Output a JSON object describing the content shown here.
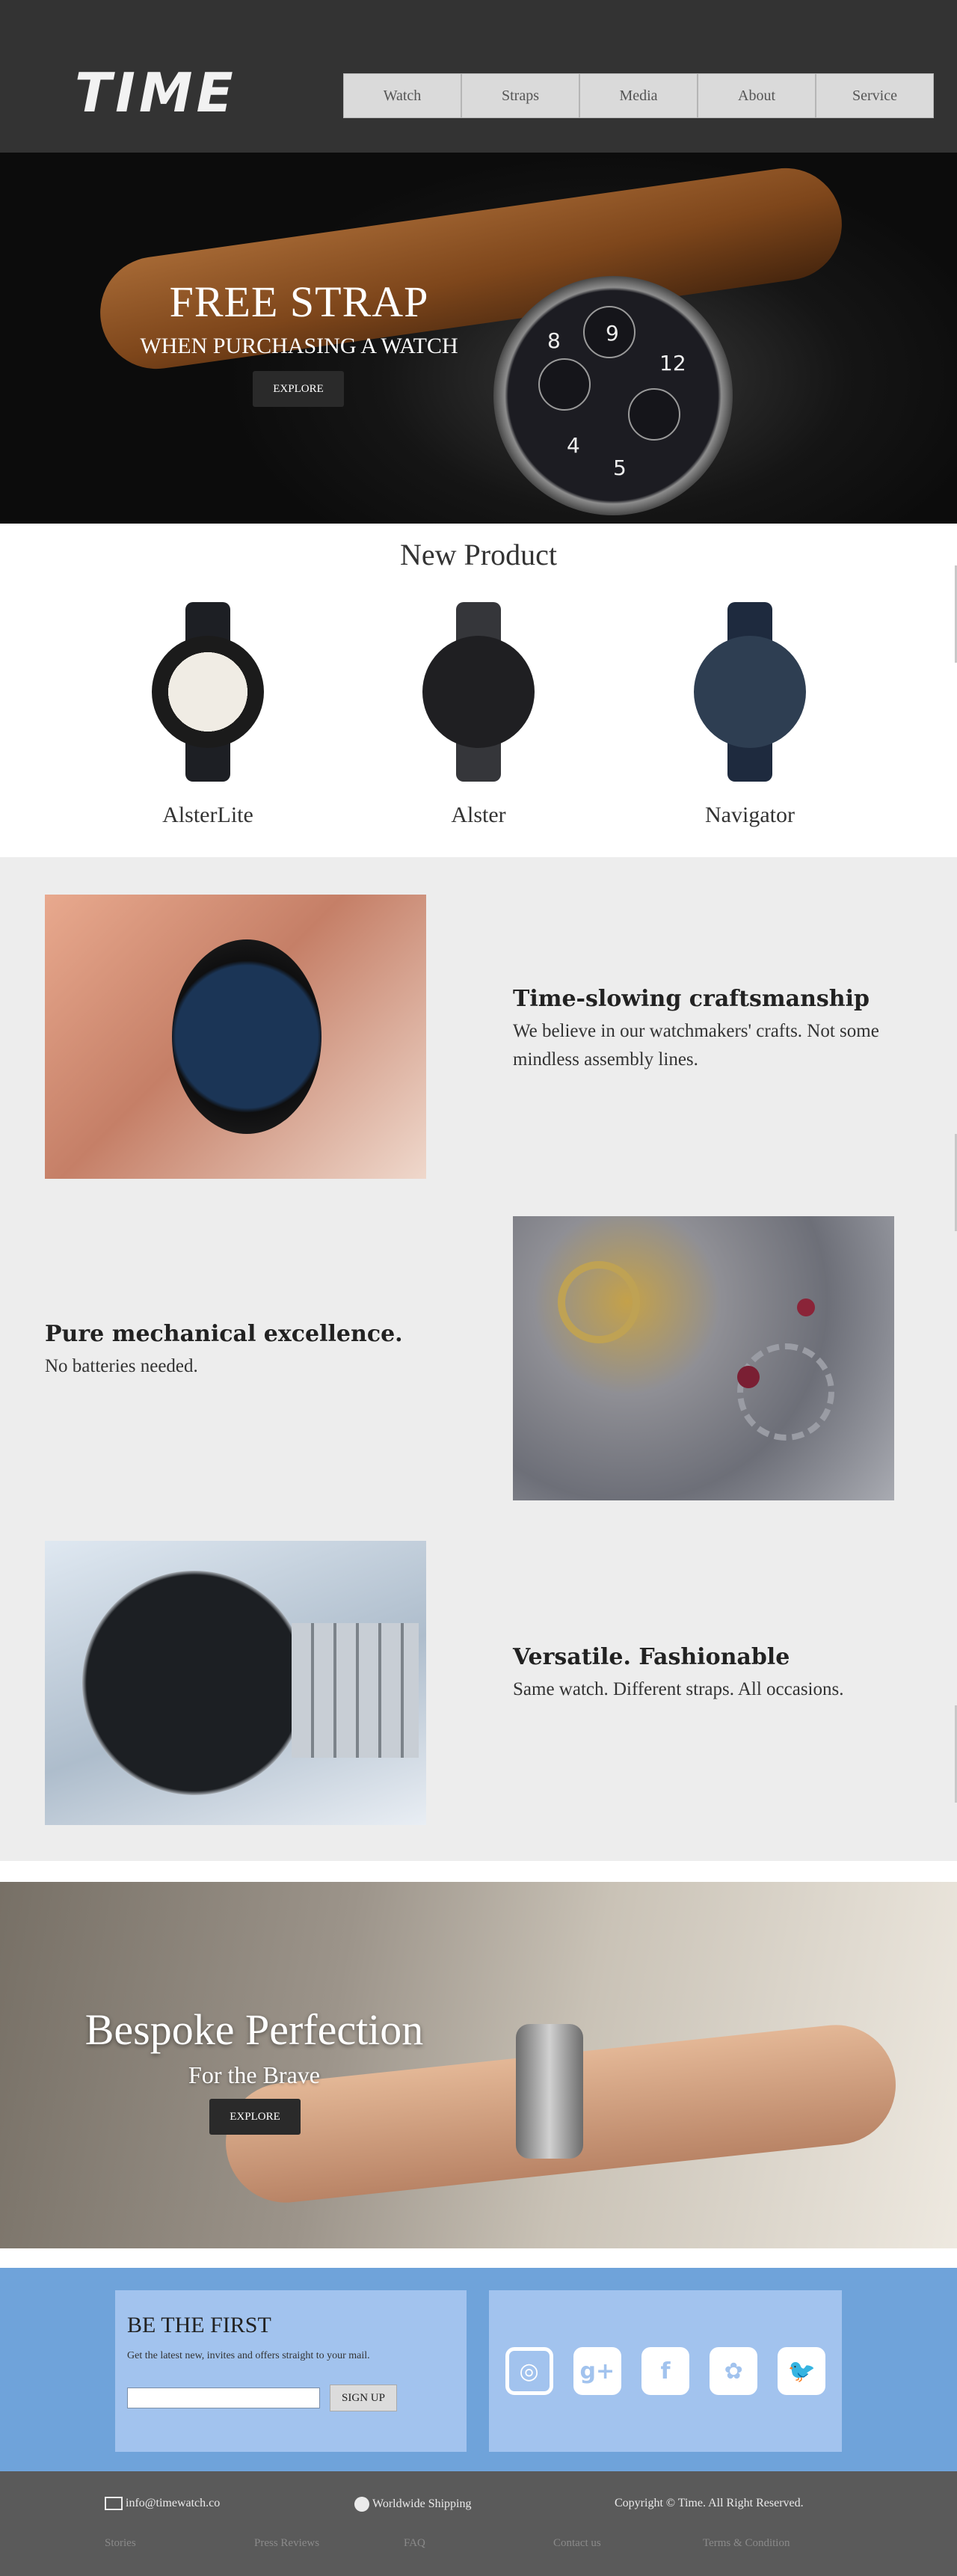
{
  "header": {
    "logo": "TIME",
    "nav": [
      "Watch",
      "Straps",
      "Media",
      "About",
      "Service"
    ]
  },
  "hero": {
    "title": "FREE STRAP",
    "subtitle": "WHEN PURCHASING A WATCH",
    "button": "EXPLORE",
    "watch_dial_numbers": [
      "8",
      "9",
      "12",
      "4",
      "5"
    ]
  },
  "new_product": {
    "title": "New Product",
    "products": [
      {
        "name": "AlsterLite",
        "strap_color": "#1d1f24",
        "case_color": "#c9a79a",
        "dial_color": "#f0ece4"
      },
      {
        "name": "Alster",
        "strap_color": "#35363a",
        "case_color": "#48494c",
        "dial_color": "#1f1f22"
      },
      {
        "name": "Navigator",
        "strap_color": "#1e2a3e",
        "case_color": "#5d6063",
        "dial_color": "#2e3e52"
      }
    ]
  },
  "features": [
    {
      "title": "Time-slowing craftsmanship",
      "body": "We believe in our watchmakers' crafts. Not some mindless assembly lines."
    },
    {
      "title": "Pure mechanical excellence.",
      "body": "No batteries needed."
    },
    {
      "title": "Versatile. Fashionable",
      "body": "Same watch. Different straps. All occasions."
    }
  ],
  "bespoke": {
    "title": "Bespoke Perfection",
    "subtitle": "For the Brave",
    "button": "EXPLORE"
  },
  "newsletter": {
    "title": "BE THE FIRST",
    "text": "Get the latest new, invites and offers straight to your mail.",
    "input_value": "",
    "button": "SIGN UP"
  },
  "social": [
    "instagram",
    "google-plus",
    "facebook",
    "snapchat",
    "twitter"
  ],
  "social_glyphs": {
    "instagram": "◎",
    "google-plus": "g+",
    "facebook": "f",
    "snapchat": "✿",
    "twitter": "🐦"
  },
  "footer": {
    "email": "info@timewatch.co",
    "shipping": "Worldwide Shipping",
    "copyright": "Copyright © Time. All Right Reserved.",
    "links": [
      "Stories",
      "Press Reviews",
      "FAQ",
      "Contact us",
      "Terms & Condition"
    ]
  },
  "colors": {
    "header_bg": "#333333",
    "newsletter_bg": "#6fa3da",
    "newsletter_panel": "#a2c3ee",
    "footer_bg": "#5a5a5a",
    "features_bg": "#ededed"
  }
}
